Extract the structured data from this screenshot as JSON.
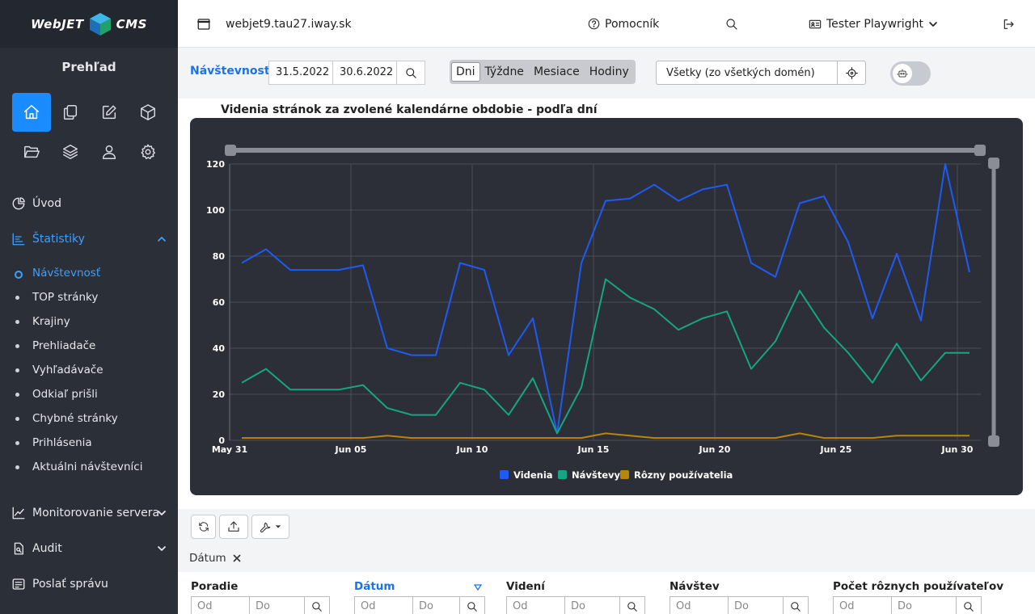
{
  "brand": {
    "left": "WebJET",
    "right": "CMS"
  },
  "sidebar": {
    "title": "Prehľad",
    "nav": [
      {
        "label": "Úvod"
      },
      {
        "label": "Štatistiky"
      },
      {
        "label": "Monitorovanie servera"
      },
      {
        "label": "Audit"
      },
      {
        "label": "Poslať správu"
      }
    ],
    "sub": [
      {
        "label": "Návštevnosť"
      },
      {
        "label": "TOP stránky"
      },
      {
        "label": "Krajiny"
      },
      {
        "label": "Prehliadače"
      },
      {
        "label": "Vyhľadávače"
      },
      {
        "label": "Odkiaľ prišli"
      },
      {
        "label": "Chybné stránky"
      },
      {
        "label": "Prihlásenia"
      },
      {
        "label": "Aktuálni návštevníci"
      }
    ]
  },
  "topbar": {
    "domain": "webjet9.tau27.iway.sk",
    "help": "Pomocník",
    "user": "Tester Playwright"
  },
  "filter": {
    "title": "Návštevnosť",
    "date_from": "31.5.2022",
    "date_to": "30.6.2022",
    "segments": [
      "Dni",
      "Týždne",
      "Mesiace",
      "Hodiny"
    ],
    "domain_select": "Všetky (zo všetkých domén)"
  },
  "chart_data": {
    "type": "line",
    "title": "Videnia stránok za zvolené kalendárne obdobie - podľa dní",
    "x": [
      "2022-05-31",
      "2022-06-01",
      "2022-06-02",
      "2022-06-03",
      "2022-06-04",
      "2022-06-05",
      "2022-06-06",
      "2022-06-07",
      "2022-06-08",
      "2022-06-09",
      "2022-06-10",
      "2022-06-11",
      "2022-06-12",
      "2022-06-13",
      "2022-06-14",
      "2022-06-15",
      "2022-06-16",
      "2022-06-17",
      "2022-06-18",
      "2022-06-19",
      "2022-06-20",
      "2022-06-21",
      "2022-06-22",
      "2022-06-23",
      "2022-06-24",
      "2022-06-25",
      "2022-06-26",
      "2022-06-27",
      "2022-06-28",
      "2022-06-29",
      "2022-06-30"
    ],
    "x_tick_labels": [
      "May 31",
      "Jun 05",
      "Jun 10",
      "Jun 15",
      "Jun 20",
      "Jun 25",
      "Jun 30"
    ],
    "ylim": [
      0,
      120
    ],
    "y_ticks": [
      0,
      20,
      40,
      60,
      80,
      100,
      120
    ],
    "grid": true,
    "legend_position": "bottom",
    "series": [
      {
        "name": "Videnia",
        "color": "#1e5bf5",
        "values": [
          77,
          83,
          74,
          74,
          74,
          76,
          40,
          37,
          37,
          77,
          74,
          37,
          53,
          3,
          77,
          104,
          105,
          111,
          104,
          109,
          111,
          77,
          71,
          103,
          106,
          86,
          53,
          81,
          52,
          120,
          73
        ]
      },
      {
        "name": "Návštevy",
        "color": "#16a583",
        "values": [
          25,
          31,
          22,
          22,
          22,
          24,
          14,
          11,
          11,
          25,
          22,
          11,
          27,
          3,
          23,
          70,
          62,
          57,
          48,
          53,
          56,
          31,
          43,
          65,
          49,
          38,
          25,
          42,
          26,
          38,
          38
        ]
      },
      {
        "name": "Rôzny používatelia",
        "color": "#b8860b",
        "values": [
          1,
          1,
          1,
          1,
          1,
          1,
          2,
          1,
          1,
          1,
          1,
          1,
          1,
          1,
          1,
          3,
          2,
          1,
          1,
          1,
          1,
          1,
          1,
          3,
          1,
          1,
          1,
          2,
          2,
          2,
          2
        ]
      }
    ]
  },
  "table": {
    "filter_chip": "Dátum",
    "columns": [
      {
        "label": "Poradie"
      },
      {
        "label": "Dátum"
      },
      {
        "label": "Videní"
      },
      {
        "label": "Návštev"
      },
      {
        "label": "Počet rôznych používateľov"
      }
    ],
    "from_placeholder": "Od",
    "to_placeholder": "Do"
  }
}
